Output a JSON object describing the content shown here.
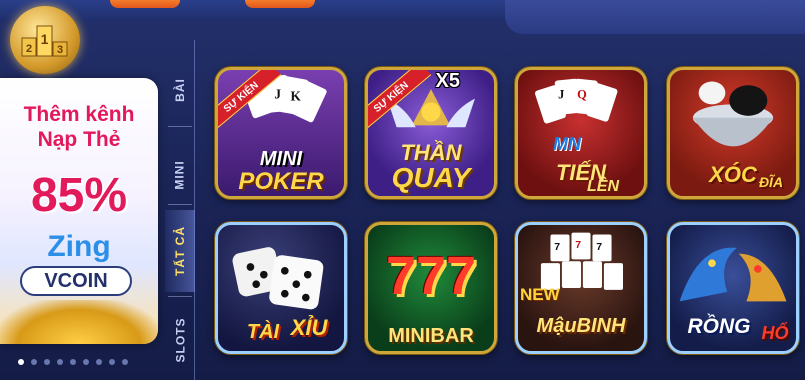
{
  "promo": {
    "line1": "Thêm kênh",
    "line2": "Nạp Thẻ",
    "percent": "85%",
    "brand": "Zing",
    "coin": "VCOIN"
  },
  "rank_badge": {
    "digits": [
      "1",
      "2",
      "3"
    ]
  },
  "tabs": [
    {
      "label": "BÀI",
      "active": false
    },
    {
      "label": "MINI",
      "active": false
    },
    {
      "label": "TẤT CẢ",
      "active": true
    },
    {
      "label": "SLOTS",
      "active": false
    }
  ],
  "pager": {
    "count": 9,
    "active_index": 0
  },
  "games": [
    {
      "title_top": "MINI",
      "title_bottom": "POKER",
      "ribbon": "SỰ KIỆN"
    },
    {
      "title_top": "THẦN",
      "title_bottom": "QUAY",
      "ribbon": "SỰ KIỆN",
      "badge": "X5"
    },
    {
      "title_top": "TIẾN",
      "title_bottom": "LÊN",
      "badge": "MN"
    },
    {
      "title_top": "XÓC",
      "title_bottom": "ĐĨA"
    },
    {
      "title_top": "TÀI",
      "title_bottom": "XỈU"
    },
    {
      "title_top": "777",
      "title_bottom": "MINIBAR"
    },
    {
      "title_top": "MậuBINH",
      "badge": "NEW"
    },
    {
      "title_top": "RỒNG",
      "title_bottom": "HỔ"
    }
  ]
}
